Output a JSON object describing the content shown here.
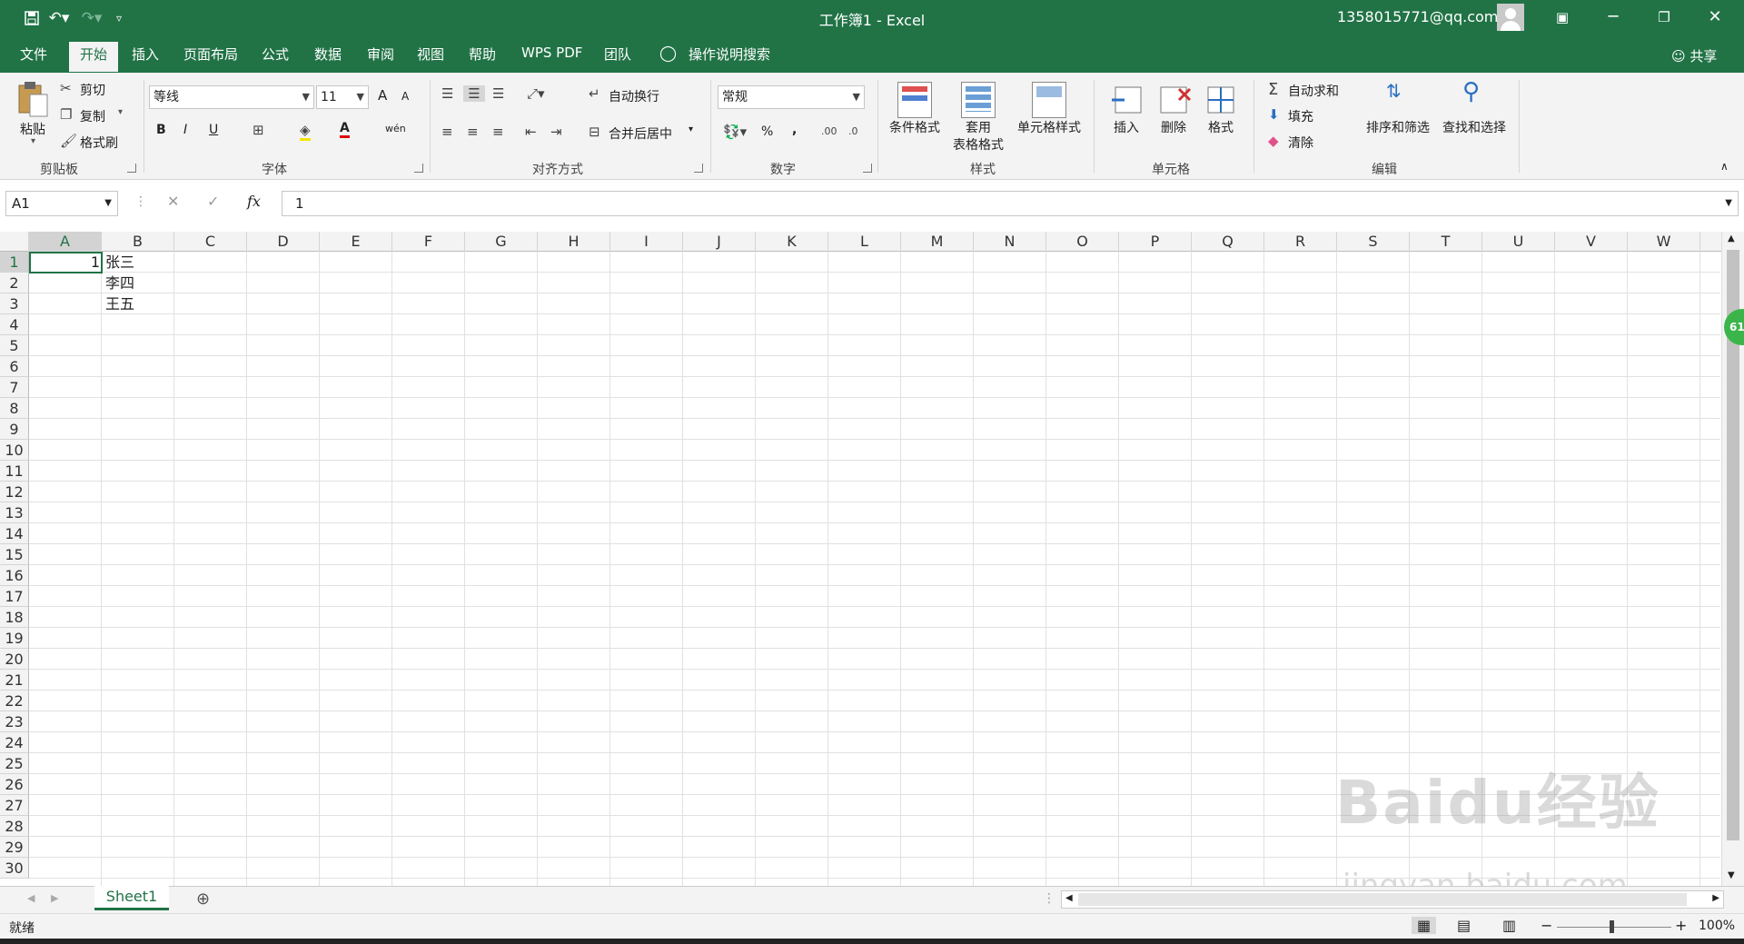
{
  "titlebar": {
    "title": "工作簿1  -  Excel",
    "user_email": "1358015771@qq.com",
    "save_icon": "save-icon",
    "undo_icon": "undo-icon",
    "redo_icon": "redo-icon"
  },
  "tabs": [
    "文件",
    "开始",
    "插入",
    "页面布局",
    "公式",
    "数据",
    "审阅",
    "视图",
    "帮助",
    "WPS PDF",
    "团队"
  ],
  "tell_me": "操作说明搜索",
  "share": "共享",
  "ribbon": {
    "clipboard": {
      "label": "剪贴板",
      "paste": "粘贴",
      "cut": "剪切",
      "copy": "复制",
      "format_painter": "格式刷"
    },
    "font": {
      "label": "字体",
      "font_name": "等线",
      "font_size": "11",
      "bold": "B",
      "italic": "I",
      "underline": "U",
      "grow": "A",
      "shrink": "A",
      "font_color": "A",
      "phonetic": "wén"
    },
    "alignment": {
      "label": "对齐方式",
      "wrap": "自动换行",
      "merge": "合并后居中"
    },
    "number": {
      "label": "数字",
      "format": "常规",
      "percent": "%",
      "comma": ","
    },
    "styles": {
      "label": "样式",
      "conditional": "条件格式",
      "table": "套用",
      "table2": "表格格式",
      "cell_styles": "单元格样式"
    },
    "cells": {
      "label": "单元格",
      "insert": "插入",
      "delete": "删除",
      "format": "格式"
    },
    "editing": {
      "label": "编辑",
      "autosum": "自动求和",
      "fill": "填充",
      "clear": "清除",
      "sort": "排序和筛选",
      "find": "查找和选择"
    }
  },
  "formula_bar": {
    "name_box": "A1",
    "fx": "fx",
    "value": "1"
  },
  "sheet": {
    "columns": [
      "A",
      "B",
      "C",
      "D",
      "E",
      "F",
      "G",
      "H",
      "I",
      "J",
      "K",
      "L",
      "M",
      "N",
      "O",
      "P",
      "Q",
      "R",
      "S",
      "T",
      "U",
      "V",
      "W"
    ],
    "rows": [
      "1",
      "2",
      "3",
      "4",
      "5",
      "6",
      "7",
      "8",
      "9",
      "10",
      "11",
      "12",
      "13",
      "14",
      "15",
      "16",
      "17",
      "18",
      "19",
      "20",
      "21",
      "22",
      "23",
      "24",
      "25",
      "26",
      "27",
      "28",
      "29",
      "30"
    ],
    "cells": {
      "A1": "1",
      "B1": "张三",
      "B2": "李四",
      "B3": "王五"
    }
  },
  "sheet_tab": "Sheet1",
  "status": {
    "ready": "就绪",
    "zoom": "100%",
    "zoom_minus": "−",
    "zoom_plus": "+"
  },
  "scroll_badge": "61",
  "watermark": {
    "brand": "Baidu经验",
    "url": "jingyan.baidu.com"
  },
  "colors": {
    "accent": "#217346",
    "ribbon_bg": "#f3f3f3"
  }
}
